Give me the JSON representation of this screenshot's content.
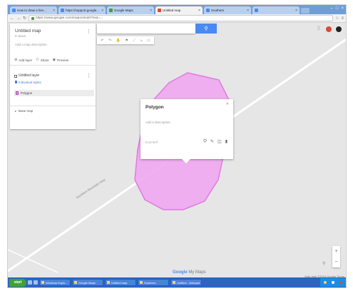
{
  "browser": {
    "tabs": [
      {
        "label": "How to draw a line...",
        "active": false,
        "color": "#4a89f2"
      },
      {
        "label": "https://support.google...",
        "active": false,
        "color": "#4a89f2"
      },
      {
        "label": "Google Maps",
        "active": false,
        "color": "#3fa13a"
      },
      {
        "label": "Untitled map",
        "active": true,
        "color": "#d84a38"
      },
      {
        "label": "Southern",
        "active": false,
        "color": "#4a89f2"
      },
      {
        "label": "",
        "active": false,
        "color": "#4a89f2"
      }
    ],
    "url": "https://www.google.com/maps/d/edit?mid=..."
  },
  "panel": {
    "title": "Untitled map",
    "views": "0 views",
    "description": "Add a map description",
    "actions": {
      "add_layer": "Add layer",
      "share": "Share",
      "preview": "Preview"
    },
    "layer_title": "Untitled layer",
    "style_link": "Individual styles",
    "item_label": "Polygon",
    "basemap": "Base map"
  },
  "map": {
    "road_label": "Southern Mountain Hwy",
    "popup": {
      "title": "Polygon",
      "description": "Add a description",
      "measure": "0.14 km²",
      "edit_icon": "pencil-icon",
      "style_icon": "paint-icon",
      "delete_icon": "trash-icon"
    },
    "logo_brand": "Google",
    "logo_product": "My Maps",
    "map_data": "Map data ©2016 Google  Terms",
    "polygon_fill": "#f0a8f0",
    "polygon_stroke": "#e070e0"
  },
  "taskbar": {
    "start": "start",
    "items": [
      "Windows Explo...",
      "Google Maps",
      "Untitled map",
      "Southern..",
      "Untitled - Notepad"
    ]
  }
}
